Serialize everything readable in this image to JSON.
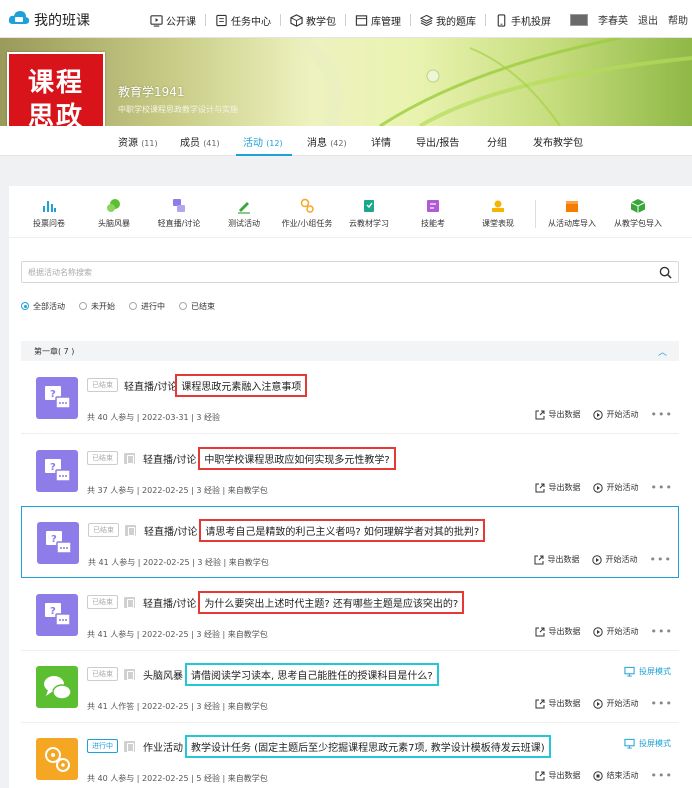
{
  "header": {
    "site_title": "我的班课",
    "nav": [
      {
        "label": "公开课",
        "icon": "play-screen-icon"
      },
      {
        "label": "任务中心",
        "icon": "task-icon"
      },
      {
        "label": "教学包",
        "icon": "package-icon"
      },
      {
        "label": "库管理",
        "icon": "library-icon"
      },
      {
        "label": "我的题库",
        "icon": "layers-icon"
      },
      {
        "label": "手机投屏",
        "icon": "phone-icon"
      }
    ],
    "user_name": "李春英",
    "logout": "退出",
    "help": "帮助"
  },
  "course": {
    "cover_line1": "课程",
    "cover_line2": "思政",
    "name": "教育学1941",
    "subtitle": "中职学校课程思政教学设计与实施"
  },
  "tabs": [
    {
      "label": "资源",
      "count": "(11)"
    },
    {
      "label": "成员",
      "count": "(41)"
    },
    {
      "label": "活动",
      "count": "(12)"
    },
    {
      "label": "消息",
      "count": "(42)"
    },
    {
      "label": "详情",
      "count": ""
    },
    {
      "label": "导出/报告",
      "count": ""
    },
    {
      "label": "分组",
      "count": ""
    },
    {
      "label": "发布教学包",
      "count": ""
    }
  ],
  "tools": [
    {
      "label": "投票问卷",
      "color": "#1ea1d8"
    },
    {
      "label": "头脑风暴",
      "color": "#5cbf32"
    },
    {
      "label": "轻直播/讨论",
      "color": "#8e7de8"
    },
    {
      "label": "测试活动",
      "color": "#3aa53a"
    },
    {
      "label": "作业/小组任务",
      "color": "#f5a623"
    },
    {
      "label": "云教材学习",
      "color": "#1aa88a"
    },
    {
      "label": "技能考",
      "color": "#b05ad6"
    },
    {
      "label": "课堂表现",
      "color": "#f5b400"
    },
    {
      "label": "从活动库导入",
      "color": "#f57c00"
    },
    {
      "label": "从教学包导入",
      "color": "#3aa53a"
    }
  ],
  "search": {
    "placeholder": "根据活动名称搜索"
  },
  "filters": [
    {
      "label": "全部活动"
    },
    {
      "label": "未开始"
    },
    {
      "label": "进行中"
    },
    {
      "label": "已结束"
    }
  ],
  "chapter": {
    "label": "第一章( 7 )"
  },
  "activities": [
    {
      "status": "已结束",
      "type": "轻直播/讨论",
      "title": "课程思政元素融入注意事项",
      "meta": "共 40 人参与  |  2022-03-31  |  3 经验",
      "action1": "导出数据",
      "action2": "开始活动"
    },
    {
      "status": "已结束",
      "type": "轻直播/讨论",
      "title": "中职学校课程思政应如何实现多元性教学?",
      "meta": "共 37 人参与  |  2022-02-25  |  3 经验 | 来自教学包",
      "action1": "导出数据",
      "action2": "开始活动"
    },
    {
      "status": "已结束",
      "type": "轻直播/讨论",
      "title": "请思考自己是精致的利己主义者吗? 如何理解学者对其的批判?",
      "meta": "共 41 人参与  |  2022-02-25  |  3 经验 | 来自教学包",
      "action1": "导出数据",
      "action2": "开始活动"
    },
    {
      "status": "已结束",
      "type": "轻直播/讨论",
      "title": "为什么要突出上述时代主题? 还有哪些主题是应该突出的?",
      "meta": "共 41 人参与  |  2022-02-25  |  3 经验 | 来自教学包",
      "action1": "导出数据",
      "action2": "开始活动"
    },
    {
      "status": "已结束",
      "type": "头脑风暴",
      "title": "请借阅读学习读本, 思考自己能胜任的授课科目是什么?",
      "meta": "共 41 人作答  |  2022-02-25  |  3 经验 | 来自教学包",
      "action1": "导出数据",
      "action2": "开始活动",
      "screen_mode": "投屏模式"
    },
    {
      "status": "进行中",
      "type": "作业活动",
      "title": "教学设计任务 (固定主题后至少挖掘课程思政元素7项, 教学设计模板待发云班课)",
      "meta": "共 40 人参与  |  2022-02-25  |  5 经验 | 来自教学包",
      "action1": "导出数据",
      "action2": "结束活动",
      "screen_mode": "投屏模式"
    }
  ]
}
